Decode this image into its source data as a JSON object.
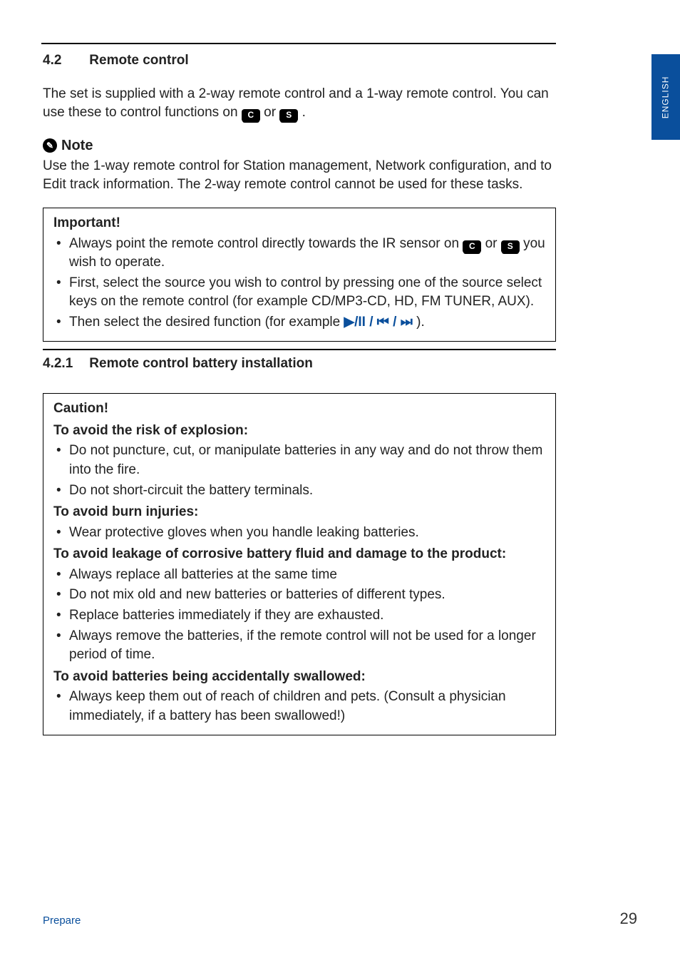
{
  "sideTab": "ENGLISH",
  "section": {
    "number": "4.2",
    "title": "Remote control",
    "intro_a": "The set is supplied with a 2-way remote control and a 1-way remote control. You can use these to control functions on ",
    "intro_b": " or ",
    "intro_c": "."
  },
  "badges": {
    "c": "C",
    "s": "S"
  },
  "note": {
    "label": "Note",
    "text": "Use the 1-way remote control for Station management, Network configuration, and to Edit track information. The 2-way remote control cannot be used for these tasks."
  },
  "important": {
    "title": "Important!",
    "li1_a": "Always point the remote control directly towards the IR sensor on ",
    "li1_b": " or ",
    "li1_c": " you wish to operate.",
    "li2": "First, select the source you wish to control by pressing one of the source select keys on the remote control (for example CD/MP3-CD, HD, FM TUNER, AUX).",
    "li3_a": "Then select the desired function (for example ",
    "li3_b": ").",
    "media": {
      "playpause": "▶/II",
      "sep": " / ",
      "prev": "⏮",
      "next": "⏭"
    }
  },
  "subsection": {
    "number": "4.2.1",
    "title": "Remote control battery installation"
  },
  "caution": {
    "title": "Caution!",
    "h1": "To avoid the risk of explosion:",
    "l1a": "Do not puncture, cut, or manipulate batteries in any way and do not throw them into the fire.",
    "l1b": "Do not short-circuit the battery terminals.",
    "h2": "To avoid burn injuries:",
    "l2a": "Wear protective gloves when you handle leaking batteries.",
    "h3": "To avoid leakage of corrosive battery fluid and damage to the product:",
    "l3a": "Always replace all batteries at the same time",
    "l3b": "Do not mix old and new batteries or batteries of different types.",
    "l3c": "Replace batteries immediately if they are exhausted.",
    "l3d": "Always remove the batteries, if the remote control will not be used for a longer period of time.",
    "h4": "To avoid batteries being accidentally swallowed:",
    "l4a": "Always keep them out of reach of children and pets. (Consult a physician immediately, if a battery has been swallowed!)"
  },
  "footer": {
    "left": "Prepare",
    "right": "29"
  }
}
